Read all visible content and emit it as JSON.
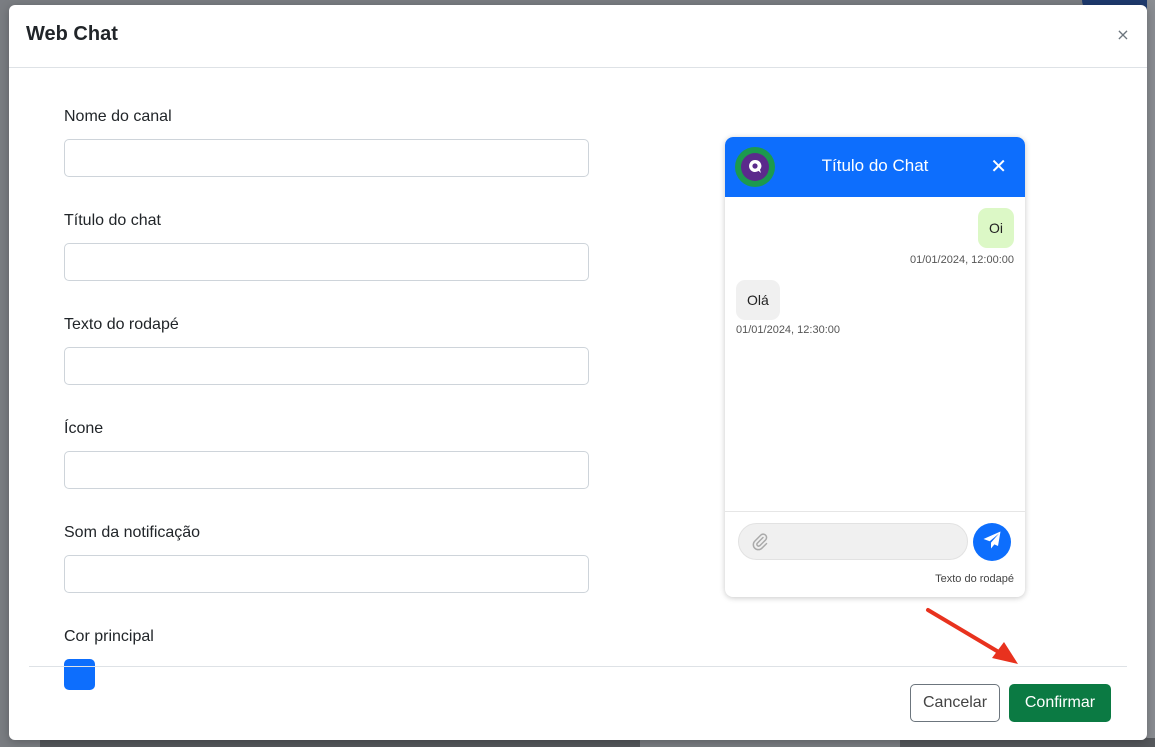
{
  "modal": {
    "title": "Web Chat",
    "close_glyph": "×"
  },
  "form": {
    "fields": [
      {
        "label": "Nome do canal",
        "value": ""
      },
      {
        "label": "Título do chat",
        "value": ""
      },
      {
        "label": "Texto do rodapé",
        "value": ""
      },
      {
        "label": "Ícone",
        "value": ""
      },
      {
        "label": "Som da notificação",
        "value": ""
      }
    ],
    "color_label": "Cor principal",
    "color_value": "#0d6efd"
  },
  "chat_preview": {
    "title": "Título do Chat",
    "close_glyph": "✕",
    "header_color": "#0d6efd",
    "messages": [
      {
        "text": "Oi",
        "timestamp": "01/01/2024, 12:00:00",
        "direction": "out",
        "color": "#dcf8c6"
      },
      {
        "text": "Olá",
        "timestamp": "01/01/2024, 12:30:00",
        "direction": "in",
        "color": "#f0f0f0"
      }
    ],
    "input_value": "",
    "footer_text": "Texto do rodapé",
    "send_color": "#0d6efd"
  },
  "actions": {
    "cancel_label": "Cancelar",
    "confirm_label": "Confirmar"
  },
  "annotation": {
    "arrow_color": "#e8321e"
  },
  "icons": [
    "close-icon",
    "chat-logo-icon",
    "paperclip-icon",
    "send-icon",
    "red-arrow-icon"
  ]
}
